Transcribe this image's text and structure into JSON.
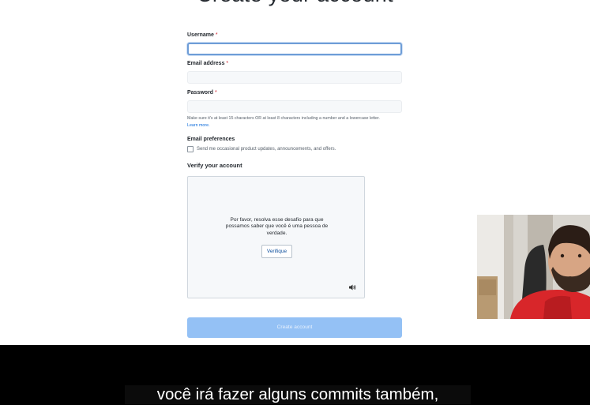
{
  "page": {
    "title": "Create your account"
  },
  "form": {
    "username_label": "Username",
    "email_label": "Email address",
    "password_label": "Password",
    "required_mark": "*",
    "password_hint": "Make sure it's at least 15 characters OR at least 8 characters including a number and a lowercase letter.",
    "learn_more": "Learn more.",
    "prefs_label": "Email preferences",
    "prefs_checkbox_label": "Send me occasional product updates, announcements, and offers.",
    "verify_label": "Verify your account",
    "submit_label": "Create account"
  },
  "captcha": {
    "message": "Por favor, resolva esse desafio para que possamos saber que você é uma pessoa de verdade.",
    "button_label": "Verifique",
    "audio_icon": "speaker-icon"
  },
  "subtitle": {
    "text": "você irá fazer alguns commits também,"
  },
  "colors": {
    "submit_disabled": "#94c1f5",
    "focus_ring": "#6e9dd7",
    "required": "#cf222e",
    "link": "#0969da"
  }
}
